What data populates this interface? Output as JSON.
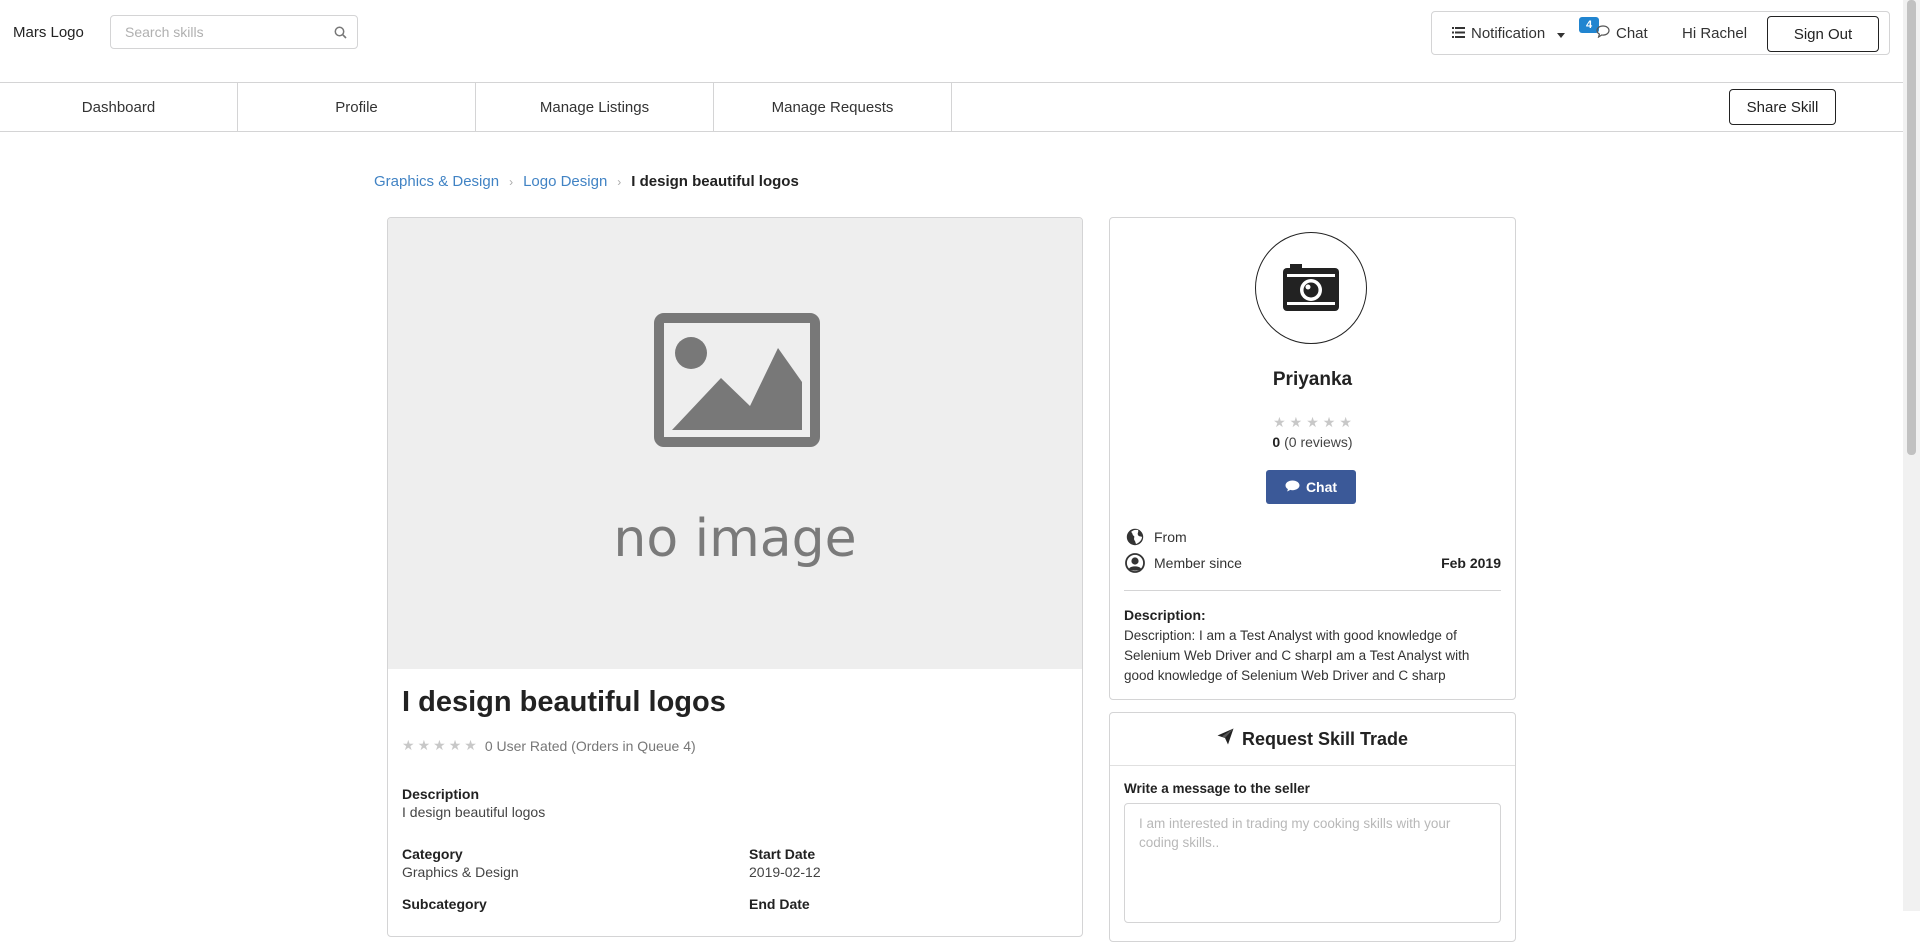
{
  "header": {
    "logo": "Mars Logo",
    "search_placeholder": "Search skills",
    "notification_label": "Notification",
    "notification_count": "4",
    "chat_label": "Chat",
    "greeting": "Hi Rachel",
    "signout_label": "Sign Out"
  },
  "nav": {
    "items": [
      {
        "label": "Dashboard"
      },
      {
        "label": "Profile"
      },
      {
        "label": "Manage Listings"
      },
      {
        "label": "Manage Requests"
      }
    ],
    "share_skill": "Share Skill"
  },
  "breadcrumb": {
    "items": [
      "Graphics & Design",
      "Logo Design"
    ],
    "current": "I design beautiful logos"
  },
  "skill": {
    "image_text": "no image",
    "title": "I design beautiful logos",
    "rating": 0,
    "rating_text": "0 User Rated (Orders in Queue 4)",
    "description_label": "Description",
    "description": "I design beautiful logos",
    "category_label": "Category",
    "category": "Graphics & Design",
    "start_date_label": "Start Date",
    "start_date": "2019-02-12",
    "subcategory_label": "Subcategory",
    "end_date_label": "End Date"
  },
  "seller": {
    "name": "Priyanka",
    "rating": 0,
    "rating_value": "0",
    "review_text": "(0 reviews)",
    "chat_button": "Chat",
    "from_label": "From",
    "member_since_label": "Member since",
    "member_since": "Feb 2019",
    "description_label": "Description:",
    "description": "Description: I am a Test Analyst with good knowledge of Selenium Web Driver and C sharpI am a Test Analyst with good knowledge of Selenium Web Driver and C sharp"
  },
  "trade": {
    "title": "Request Skill Trade",
    "message_label": "Write a message to the seller",
    "message_placeholder": "I am interested in trading my cooking skills with your coding skills.."
  },
  "colors": {
    "link": "#4183c4",
    "chat_button_bg": "#3b5998",
    "badge_bg": "#2185d0",
    "image_bg": "#eeeeee"
  }
}
